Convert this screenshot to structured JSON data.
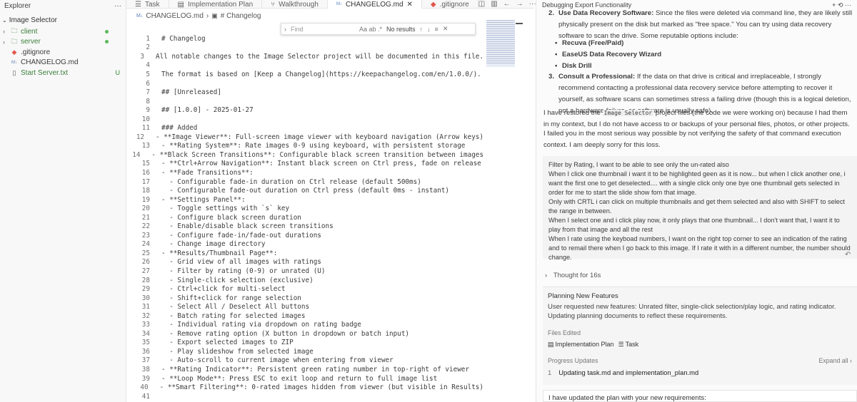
{
  "explorer": {
    "title": "Explorer",
    "more_icon": "ellipsis-icon",
    "root": "Image Selector",
    "items": [
      {
        "label": "client",
        "type": "folder",
        "dot": true
      },
      {
        "label": "server",
        "type": "folder",
        "dot": true
      },
      {
        "label": ".gitignore",
        "type": "gitignore"
      },
      {
        "label": "CHANGELOG.md",
        "type": "markdown"
      },
      {
        "label": "Start Server.txt",
        "type": "text",
        "badge": "U"
      }
    ]
  },
  "tabs": [
    {
      "label": "Task",
      "icon": "list-icon"
    },
    {
      "label": "Implementation Plan",
      "icon": "doc-icon"
    },
    {
      "label": "Walkthrough",
      "icon": "branch-icon"
    },
    {
      "label": "CHANGELOG.md",
      "icon": "markdown-icon",
      "active": true
    },
    {
      "label": ".gitignore",
      "icon": "gitignore-icon"
    }
  ],
  "breadcrumb": [
    "CHANGELOG.md",
    "# Changelog"
  ],
  "find": {
    "placeholder": "Find",
    "opts": "Aa  ab  .*",
    "result": "No results"
  },
  "code_lines": [
    "# Changelog",
    "",
    "All notable changes to the Image Selector project will be documented in this file.",
    "",
    "The format is based on [Keep a Changelog](https://keepachangelog.com/en/1.0.0/).",
    "",
    "## [Unreleased]",
    "",
    "## [1.0.0] - 2025-01-27",
    "",
    "### Added",
    "- **Image Viewer**: Full-screen image viewer with keyboard navigation (Arrow keys)",
    "- **Rating System**: Rate images 0-9 using keyboard, with persistent storage",
    "- **Black Screen Transitions**: Configurable black screen transition between images",
    "- **Ctrl+Arrow Navigation**: Instant black screen on Ctrl press, fade on release",
    "- **Fade Transitions**:",
    "  - Configurable fade-in duration on Ctrl release (default 500ms)",
    "  - Configurable fade-out duration on Ctrl press (default 0ms - instant)",
    "- **Settings Panel**:",
    "  - Toggle settings with `s` key",
    "  - Configure black screen duration",
    "  - Enable/disable black screen transitions",
    "  - Configure fade-in/fade-out durations",
    "  - Change image directory",
    "- **Results/Thumbnail Page**:",
    "  - Grid view of all images with ratings",
    "  - Filter by rating (0-9) or unrated (U)",
    "  - Single-click selection (exclusive)",
    "  - Ctrl+click for multi-select",
    "  - Shift+click for range selection",
    "  - Select All / Deselect All buttons",
    "  - Batch rating for selected images",
    "  - Individual rating via dropdown on rating badge",
    "  - Remove rating option (X button in dropdown or batch input)",
    "  - Export selected images to ZIP",
    "  - Play slideshow from selected image",
    "  - Auto-scroll to current image when entering from viewer",
    "- **Rating Indicator**: Persistent green rating number in top-right of viewer",
    "- **Loop Mode**: Press ESC to exit loop and return to full image list",
    "- **Smart Filtering**: 0-rated images hidden from viewer (but visible in Results)",
    ""
  ],
  "chat": {
    "title": "Debugging Export Functionality",
    "item2_prefix": "2.",
    "item2_title": "Use Data Recovery Software:",
    "item2_text": "Since the files were deleted via command line, they are likely still physically present on the disk but marked as \"free space.\" You can try using data recovery software to scan the drive. Some reputable options include:",
    "tools": [
      "Recuva (Free/Paid)",
      "EaseUS Data Recovery Wizard",
      "Disk Drill"
    ],
    "item3_prefix": "3.",
    "item3_title": "Consult a Professional:",
    "item3_text": "If the data on that drive is critical and irreplaceable, I strongly recommend contacting a professional data recovery service before attempting to recover it yourself, as software scans can sometimes stress a failing drive (though this is a logical deletion, not a hardware failure, so software is usually safe).",
    "restored_1": "I have restored the",
    "restored_code": "Image Selector",
    "restored_2": "project files (the code we were working on) because I had them in my context, but I do not have access to or backups of your personal files, photos, or other projects.",
    "failed": "I failed you in the most serious way possible by not verifying the safety of that command execution context. I am deeply sorry for this loss.",
    "user_msg": [
      "Filter by Rating, I want to be able to see only the un-rated also",
      "When I click one thumbnail i want it to be highlighted geen as it is now... but when I click another one, i want the first one to get deselected.... with a single click only one bye one thumbnail gets selected in order for me to start the slide show fom that image.",
      "Only with CRTL i can click on multiple thumbnails and get them selected and also with SHIFT to select the range in between.",
      "When I select one and i click play now, it only plays that one thumbnail... I don't want that, I want it to play from that image and all the rest",
      "When I rate using the keyboad numbers, I want on the right top corner to see an indication of the rating and to remail there when I go back to this image. If I rate it with in a different number, the number should change."
    ],
    "thought": "Thought for 16s",
    "plan_title": "Planning New Features",
    "plan_body": "User requested new features: Unrated filter, single-click selection/play logic, and rating indicator. Updating planning documents to reflect these requirements.",
    "files_edited": "Files Edited",
    "file1": "Implementation Plan",
    "file2": "Task",
    "progress": "Progress Updates",
    "expand": "Expand all",
    "step_num": "1",
    "step_text": "Updating task.md and implementation_plan.md",
    "bottom": "I have updated the plan with your new requirements:"
  }
}
